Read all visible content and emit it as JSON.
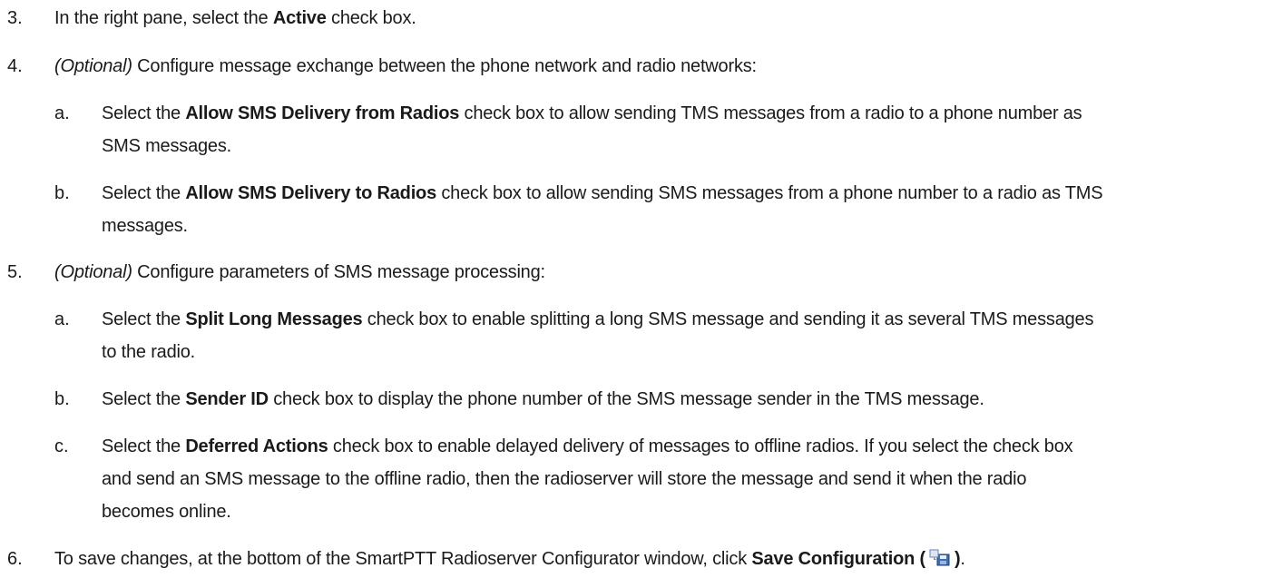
{
  "steps": {
    "s3": {
      "number": "3.",
      "pre": "In the right pane, select the ",
      "bold": "Active",
      "post": " check box."
    },
    "s4": {
      "number": "4.",
      "optional": "(Optional)",
      "text": " Configure message exchange between the phone network and radio networks:",
      "a": {
        "letter": "a.",
        "pre": "Select the ",
        "bold": "Allow SMS Delivery from Radios",
        "post1": " check box to allow sending TMS messages from a radio to a phone number as",
        "post2": "SMS messages."
      },
      "b": {
        "letter": "b.",
        "pre": "Select the ",
        "bold": "Allow SMS Delivery to Radios",
        "post1": " check box to allow sending SMS messages from a phone number to a radio as TMS",
        "post2": "messages."
      }
    },
    "s5": {
      "number": "5.",
      "optional": "(Optional)",
      "text": " Configure parameters of SMS message processing:",
      "a": {
        "letter": "a.",
        "pre": "Select the ",
        "bold": "Split Long Messages",
        "post1": " check box to enable splitting a long SMS message and sending it as several TMS messages",
        "post2": "to the radio."
      },
      "b": {
        "letter": "b.",
        "pre": "Select the ",
        "bold": "Sender ID",
        "post1": " check box to display the phone number of the SMS message sender in the TMS message."
      },
      "c": {
        "letter": "c.",
        "pre": "Select the ",
        "bold": "Deferred Actions",
        "post1": " check box to enable delayed delivery of messages to offline radios. If you select the check box",
        "post2": "and send an SMS message to the offline radio, then the radioserver will store the message and send it when the radio",
        "post3": "becomes online."
      }
    },
    "s6": {
      "number": "6.",
      "pre": "To save changes, at the bottom of the SmartPTT Radioserver Configurator window, click ",
      "bold": "Save Configuration (",
      "bold_close": ")",
      "post": ".",
      "icon": "save-configuration-icon"
    }
  }
}
